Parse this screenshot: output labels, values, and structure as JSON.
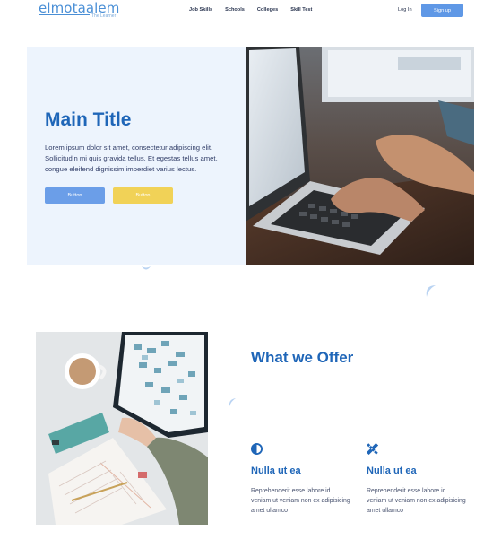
{
  "header": {
    "logo_main": "elmotaalem",
    "logo_sub": "The Learner",
    "nav": [
      "Job Skills",
      "Schools",
      "Colleges",
      "Skill Test"
    ],
    "login": "Log In",
    "signup": "Sign up"
  },
  "hero": {
    "title": "Main Title",
    "text": "Lorem ipsum dolor sit amet, consectetur adipiscing elit. Sollicitudin mi quis gravida tellus. Et egestas tellus amet, congue eleifend dignissim imperdiet varius lectus.",
    "button_primary": "Button",
    "button_secondary": "Button"
  },
  "offer": {
    "title": "What we Offer",
    "features": [
      {
        "icon": "half-circle-icon",
        "title": "Nulla ut ea",
        "text": "Reprehenderit esse labore id veniam ut veniam non ex adipisicing amet ullamco"
      },
      {
        "icon": "pencil-ruler-icon",
        "title": "Nulla ut ea",
        "text": "Reprehenderit esse labore id veniam ut veniam non ex adipisicing amet ullamco"
      }
    ]
  },
  "colors": {
    "accent": "#1f66b8",
    "button_blue": "#6b9ee8",
    "button_yellow": "#f1d257",
    "hero_bg": "#edf4fd"
  }
}
